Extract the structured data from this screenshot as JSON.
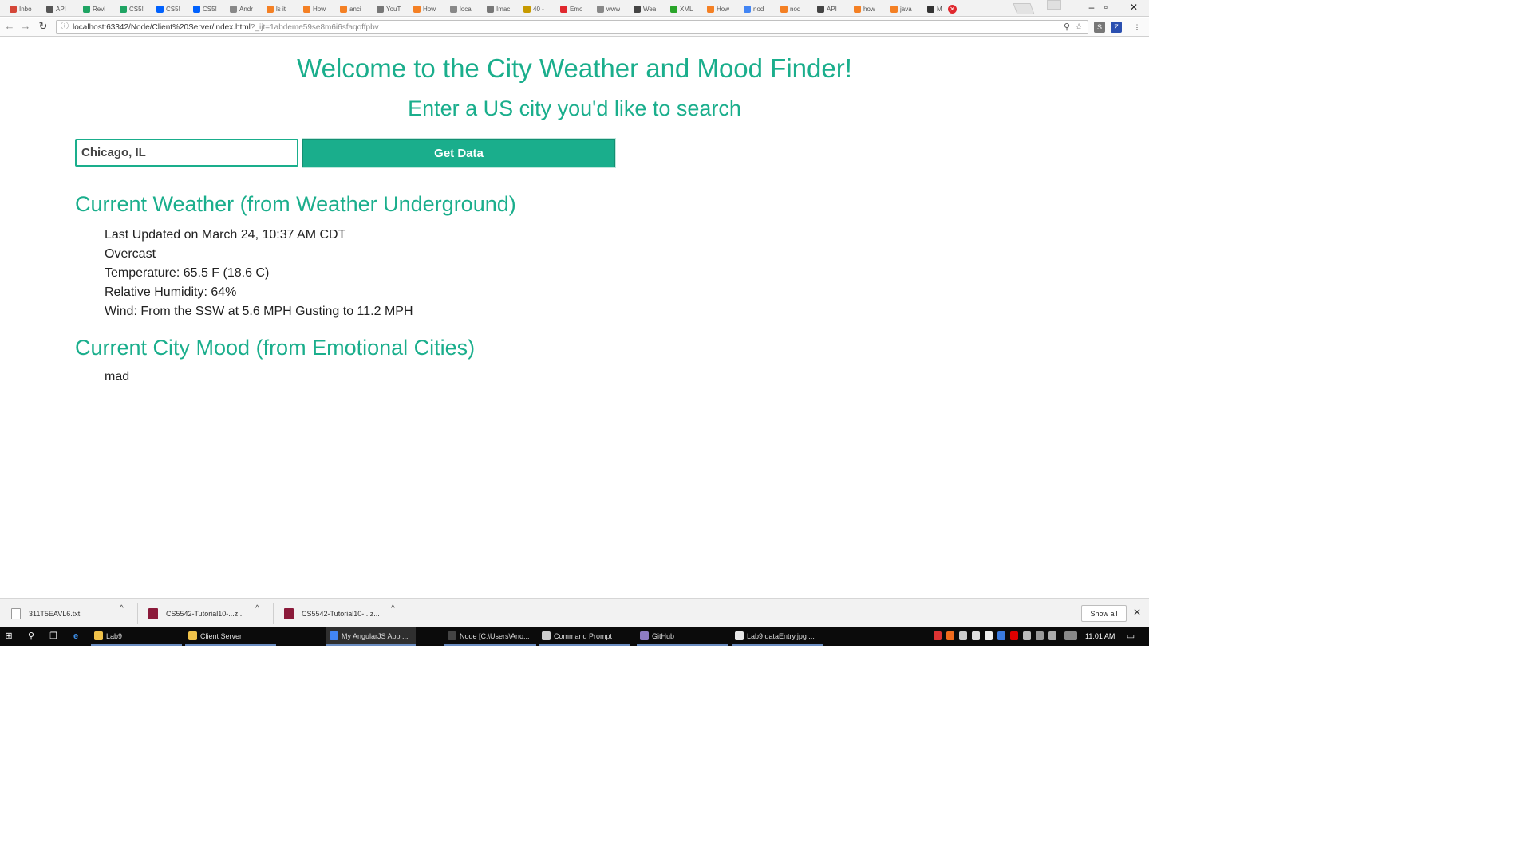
{
  "browser": {
    "tabs": [
      {
        "label": "Inbo",
        "color": "#d44638"
      },
      {
        "label": "API",
        "color": "#555555"
      },
      {
        "label": "Revi",
        "color": "#1fa463"
      },
      {
        "label": "CS5!",
        "color": "#1fa463"
      },
      {
        "label": "CS5!",
        "color": "#0061fe"
      },
      {
        "label": "CS5!",
        "color": "#0061fe"
      },
      {
        "label": "Andr",
        "color": "#888888"
      },
      {
        "label": "ls it",
        "color": "#f48024"
      },
      {
        "label": "How",
        "color": "#f48024"
      },
      {
        "label": "anci",
        "color": "#f48024"
      },
      {
        "label": "YouT",
        "color": "#777777"
      },
      {
        "label": "How",
        "color": "#f48024"
      },
      {
        "label": "local",
        "color": "#888888"
      },
      {
        "label": "Imac",
        "color": "#777777"
      },
      {
        "label": "40 -",
        "color": "#c79a00"
      },
      {
        "label": "Emo",
        "color": "#e0282e"
      },
      {
        "label": "www",
        "color": "#888888"
      },
      {
        "label": "Wea",
        "color": "#444444"
      },
      {
        "label": "XML",
        "color": "#2aa52a"
      },
      {
        "label": "How",
        "color": "#f48024"
      },
      {
        "label": "nod",
        "color": "#4285f4"
      },
      {
        "label": "nod",
        "color": "#f48024"
      },
      {
        "label": "API",
        "color": "#444444"
      },
      {
        "label": "how",
        "color": "#f48024"
      },
      {
        "label": "java",
        "color": "#f48024"
      },
      {
        "label": "M",
        "color": "#333333"
      }
    ],
    "url_main": "localhost:63342/Node/Client%20Server/index.html",
    "url_query": "?_ijt=1abdeme59se8m6i6sfaqoffpbv",
    "window_buttons": {
      "minimize": "–",
      "maximize": "▫",
      "close": "✕"
    }
  },
  "page": {
    "heading": "Welcome to the City Weather and Mood Finder!",
    "subheading": "Enter a US city you'd like to search",
    "city_input_value": "Chicago, IL",
    "get_data_label": "Get Data",
    "weather_title": "Current Weather (from Weather Underground)",
    "weather_lines": [
      "Last Updated on March 24, 10:37 AM CDT",
      "Overcast",
      "Temperature: 65.5 F (18.6 C)",
      "Relative Humidity: 64%",
      "Wind: From the SSW at 5.6 MPH Gusting to 11.2 MPH"
    ],
    "mood_title": "Current City Mood (from Emotional Cities)",
    "mood_value": "mad",
    "accent_color": "#1aae8c"
  },
  "downloads": {
    "items": [
      {
        "name": "311T5EAVL6.txt",
        "icon_color": "#888888"
      },
      {
        "name": "CS5542-Tutorial10-...z...",
        "icon_color": "#8b1a3a"
      },
      {
        "name": "CS5542-Tutorial10-...z...",
        "icon_color": "#8b1a3a"
      }
    ],
    "show_all_label": "Show all",
    "close_glyph": "✕"
  },
  "taskbar": {
    "apps": [
      {
        "label": "Lab9",
        "icon_color": "#f0c24a",
        "active": false
      },
      {
        "label": "Client Server",
        "icon_color": "#f0c24a",
        "active": false
      },
      {
        "label": "My AngularJS App ...",
        "icon_color": "#4285f4",
        "active": true
      },
      {
        "label": "Node   [C:\\Users\\Ano...",
        "icon_color": "#444444",
        "active": false
      },
      {
        "label": "Command Prompt",
        "icon_color": "#cccccc",
        "active": false
      },
      {
        "label": "GitHub",
        "icon_color": "#8e7cc3",
        "active": false
      },
      {
        "label": "Lab9 dataEntry.jpg ...",
        "icon_color": "#e8e8e8",
        "active": false
      }
    ],
    "time": "11:01 AM"
  }
}
